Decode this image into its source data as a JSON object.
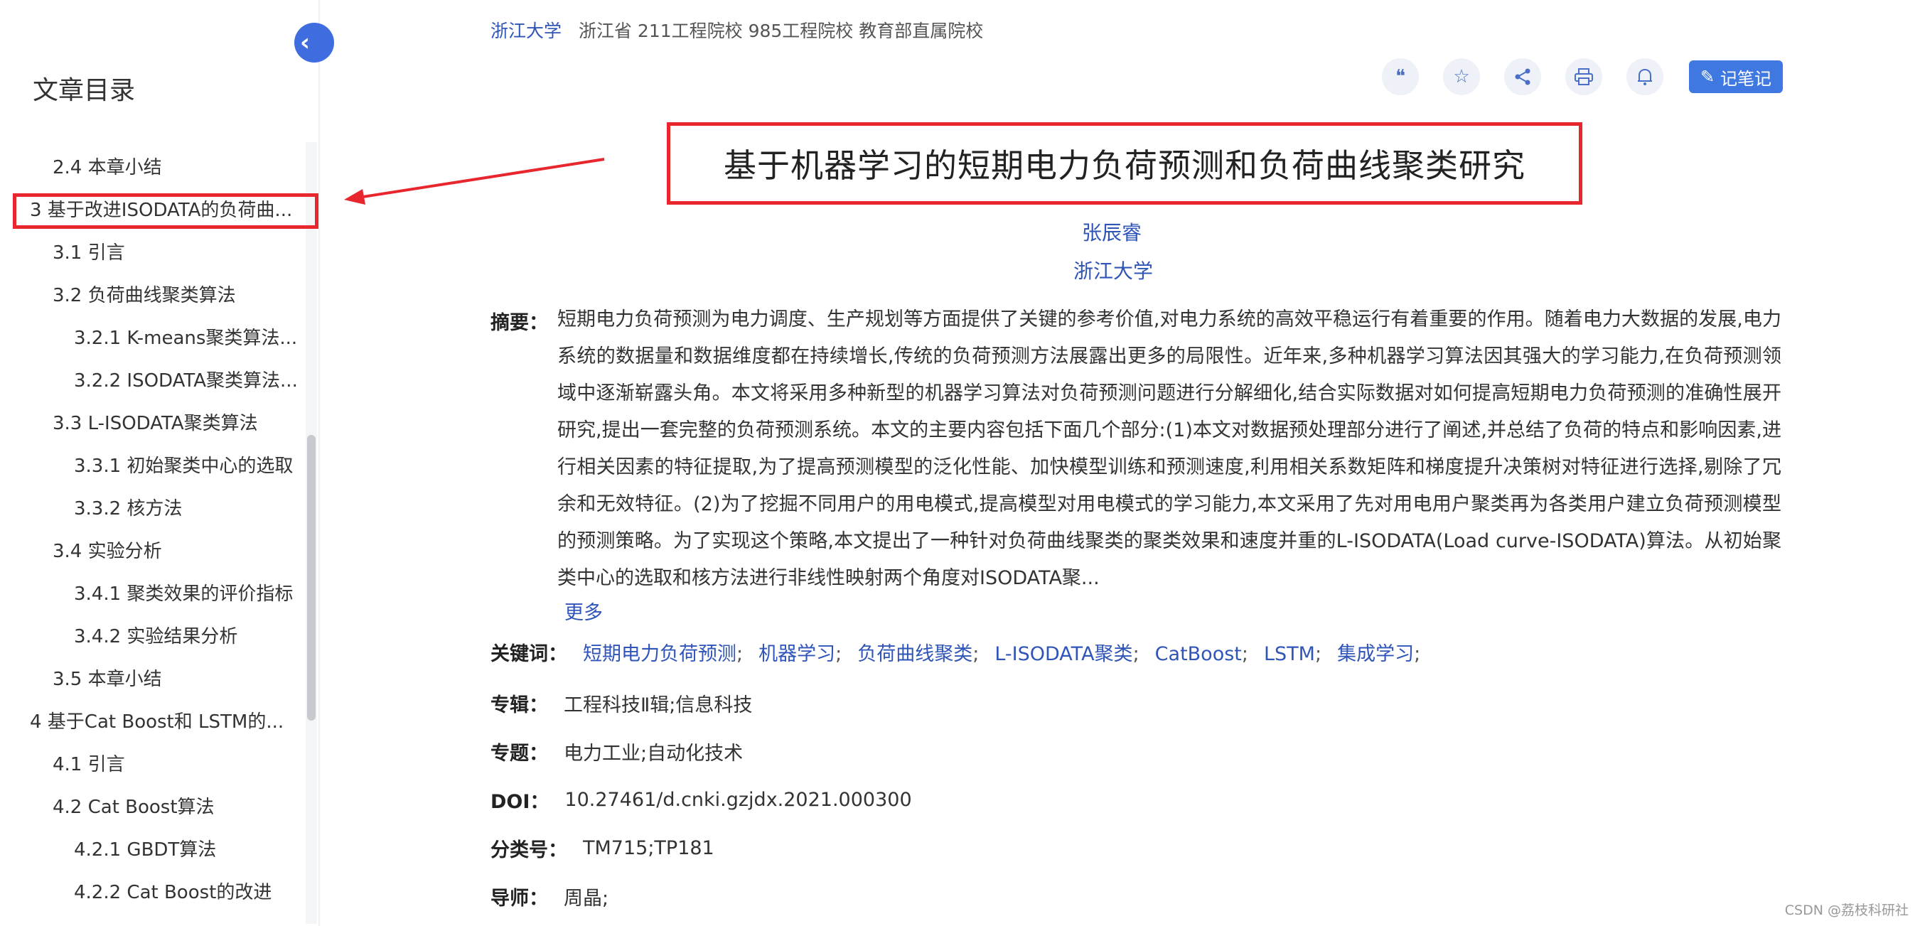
{
  "sidebar": {
    "title": "文章目录",
    "collapse_icon": "‹",
    "items": [
      {
        "label": "2.4 本章小结",
        "level": 2
      },
      {
        "label": "3 基于改进ISODATA的负荷曲...",
        "level": 1
      },
      {
        "label": "3.1 引言",
        "level": 2
      },
      {
        "label": "3.2 负荷曲线聚类算法",
        "level": 2
      },
      {
        "label": "3.2.1 K-means聚类算法...",
        "level": 3
      },
      {
        "label": "3.2.2 ISODATA聚类算法...",
        "level": 3
      },
      {
        "label": "3.3 L-ISODATA聚类算法",
        "level": 2
      },
      {
        "label": "3.3.1 初始聚类中心的选取",
        "level": 3
      },
      {
        "label": "3.3.2 核方法",
        "level": 3
      },
      {
        "label": "3.4 实验分析",
        "level": 2
      },
      {
        "label": "3.4.1 聚类效果的评价指标",
        "level": 3
      },
      {
        "label": "3.4.2 实验结果分析",
        "level": 3
      },
      {
        "label": "3.5 本章小结",
        "level": 2
      },
      {
        "label": "4 基于Cat Boost和 LSTM的...",
        "level": 1
      },
      {
        "label": "4.1 引言",
        "level": 2
      },
      {
        "label": "4.2 Cat Boost算法",
        "level": 2
      },
      {
        "label": "4.2.1 GBDT算法",
        "level": 3
      },
      {
        "label": "4.2.2 Cat Boost的改进",
        "level": 3
      }
    ]
  },
  "header": {
    "institution": "浙江大学",
    "institution_tags": "浙江省 211工程院校 985工程院校 教育部直属院校"
  },
  "toolbar": {
    "icons": [
      {
        "name": "quote-icon",
        "glyph": "❝"
      },
      {
        "name": "star-icon",
        "glyph": "☆"
      },
      {
        "name": "share-icon",
        "glyph": "⋖"
      },
      {
        "name": "print-icon",
        "glyph": "⎙"
      },
      {
        "name": "bell-icon",
        "glyph": "🔔"
      }
    ],
    "note_label": "记笔记",
    "note_icon": "✎"
  },
  "article": {
    "title": "基于机器学习的短期电力负荷预测和负荷曲线聚类研究",
    "author": "张辰睿",
    "organization": "浙江大学",
    "abstract_label": "摘要：",
    "abstract": "短期电力负荷预测为电力调度、生产规划等方面提供了关键的参考价值,对电力系统的高效平稳运行有着重要的作用。随着电力大数据的发展,电力系统的数据量和数据维度都在持续增长,传统的负荷预测方法展露出更多的局限性。近年来,多种机器学习算法因其强大的学习能力,在负荷预测领域中逐渐崭露头角。本文将采用多种新型的机器学习算法对负荷预测问题进行分解细化,结合实际数据对如何提高短期电力负荷预测的准确性展开研究,提出一套完整的负荷预测系统。本文的主要内容包括下面几个部分:(1)本文对数据预处理部分进行了阐述,并总结了负荷的特点和影响因素,进行相关因素的特征提取,为了提高预测模型的泛化性能、加快模型训练和预测速度,利用相关系数矩阵和梯度提升决策树对特征进行选择,剔除了冗余和无效特征。(2)为了挖掘不同用户的用电模式,提高模型对用电模式的学习能力,本文采用了先对用电用户聚类再为各类用户建立负荷预测模型的预测策略。为了实现这个策略,本文提出了一种针对负荷曲线聚类的聚类效果和速度并重的L-ISODATA(Load curve-ISODATA)算法。从初始聚类中心的选取和核方法进行非线性映射两个角度对ISODATA聚...",
    "more_label": "更多",
    "keywords_label": "关键词：",
    "keywords": [
      "短期电力负荷预测",
      "机器学习",
      "负荷曲线聚类",
      "L-ISODATA聚类",
      "CatBoost",
      "LSTM",
      "集成学习"
    ],
    "keyword_sep": ";",
    "series_label": "专辑：",
    "series": "工程科技Ⅱ辑;信息科技",
    "topic_label": "专题：",
    "topic": "电力工业;自动化技术",
    "doi_label": "DOI：",
    "doi": "10.27461/d.cnki.gzjdx.2021.000300",
    "class_label": "分类号：",
    "class_no": "TM715;TP181",
    "advisor_label": "导师：",
    "advisor": "周晶;"
  },
  "watermark": "CSDN @荔枝科研社",
  "colors": {
    "accent": "#3f78e0",
    "link": "#2f55b8",
    "highlight": "#e8262e"
  }
}
